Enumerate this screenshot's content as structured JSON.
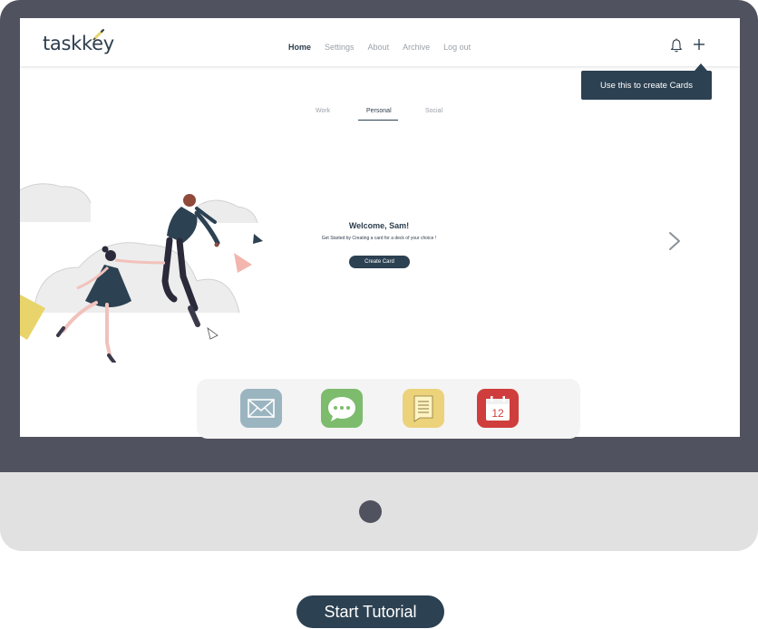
{
  "app": {
    "logo_text": "taskkey"
  },
  "nav": {
    "items": [
      {
        "label": "Home",
        "active": true
      },
      {
        "label": "Settings",
        "active": false
      },
      {
        "label": "About",
        "active": false
      },
      {
        "label": "Archive",
        "active": false
      },
      {
        "label": "Log out",
        "active": false
      }
    ]
  },
  "header_icons": {
    "notifications": "bell-icon",
    "create": "plus-icon"
  },
  "tooltip": {
    "text": "Use this to create Cards"
  },
  "tabs": [
    {
      "label": "Work",
      "active": false
    },
    {
      "label": "Personal",
      "active": true
    },
    {
      "label": "Social",
      "active": false
    }
  ],
  "welcome": {
    "title": "Welcome, Sam!",
    "subtitle": "Get Started by Creating a card for a deck of your choice !",
    "create_button": "Create Card"
  },
  "dock": {
    "apps": [
      {
        "name": "mail",
        "icon": "envelope-icon",
        "color": "#9bb5c0"
      },
      {
        "name": "messages",
        "icon": "chat-bubble-icon",
        "color": "#7cbc6c"
      },
      {
        "name": "notes",
        "icon": "note-icon",
        "color": "#ecd27a"
      },
      {
        "name": "calendar",
        "icon": "calendar-icon",
        "color": "#cf3e3c",
        "day": "12"
      }
    ]
  },
  "tutorial_button": "Start Tutorial",
  "colors": {
    "primary": "#2c4152",
    "bezel": "#51525f",
    "chin": "#e1e1e1",
    "accent_pink": "#f2b6ae",
    "accent_yellow": "#e8d46a"
  }
}
